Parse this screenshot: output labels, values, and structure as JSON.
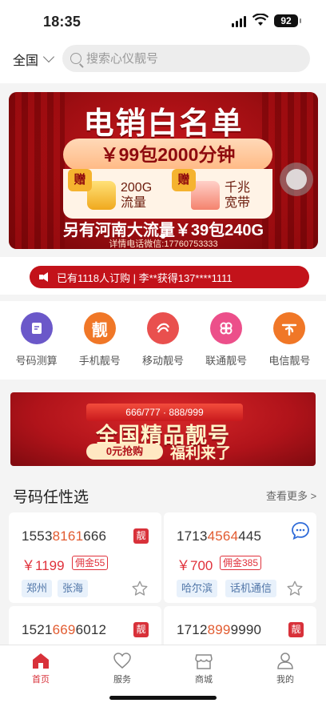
{
  "status": {
    "time": "18:35",
    "battery": "92"
  },
  "header": {
    "region": "全国",
    "search_placeholder": "搜索心仪靓号"
  },
  "banner": {
    "title": "电销白名单",
    "price": "￥99包2000分钟",
    "gift_badge": "赠",
    "gift1": "200G流量",
    "gift1_l1": "200G",
    "gift1_l2": "流量",
    "gift2_l1": "千兆",
    "gift2_l2": "宽带",
    "subtitle": "另有河南大流量￥39包240G",
    "contact": "详情电话微信:17760753333"
  },
  "notice": "已有1118人订购 | 李**获得137****1111",
  "categories": [
    {
      "label": "号码测算",
      "icon": "calculator-icon",
      "color": "#6b58c9"
    },
    {
      "label": "手机靓号",
      "icon": "liang-icon",
      "glyph": "靓",
      "color": "#f07727"
    },
    {
      "label": "移动靓号",
      "icon": "china-mobile-icon",
      "color": "#e9504e"
    },
    {
      "label": "联通靓号",
      "icon": "china-unicom-icon",
      "color": "#ec4f8a"
    },
    {
      "label": "电信靓号",
      "icon": "china-telecom-icon",
      "color": "#f07727"
    }
  ],
  "promo": {
    "ribbon": "666/777 · 888/999",
    "title": "全国精品靓号",
    "button": "0元抢购",
    "slogan": "福利来了"
  },
  "section": {
    "title": "号码任性选",
    "more": "查看更多 >"
  },
  "numbers": [
    {
      "pre": "1553",
      "hl": "8161",
      "post": "666",
      "badge": "靓",
      "price": "￥1199",
      "commission": "佣金55",
      "tags": [
        "郑州",
        "张海"
      ]
    },
    {
      "pre": "1713",
      "hl": "4564",
      "post": "445",
      "badge": "靓",
      "price": "￥700",
      "commission": "佣金385",
      "tags": [
        "哈尔滨",
        "话机通信"
      ]
    },
    {
      "pre": "1521",
      "hl": "669",
      "post": "6012",
      "badge": "靓",
      "price": "",
      "commission": "",
      "tags": []
    },
    {
      "pre": "1712",
      "hl": "899",
      "post": "9990",
      "badge": "靓",
      "price": "",
      "commission": "",
      "tags": []
    }
  ],
  "tabs": [
    {
      "label": "首页",
      "icon": "home-icon",
      "active": true
    },
    {
      "label": "服务",
      "icon": "heart-icon",
      "active": false
    },
    {
      "label": "商城",
      "icon": "shop-icon",
      "active": false
    },
    {
      "label": "我的",
      "icon": "user-icon",
      "active": false
    }
  ],
  "colors": {
    "brand_red": "#c3121a",
    "highlight": "#e25b30",
    "tag_bg": "#e8f1fb"
  }
}
